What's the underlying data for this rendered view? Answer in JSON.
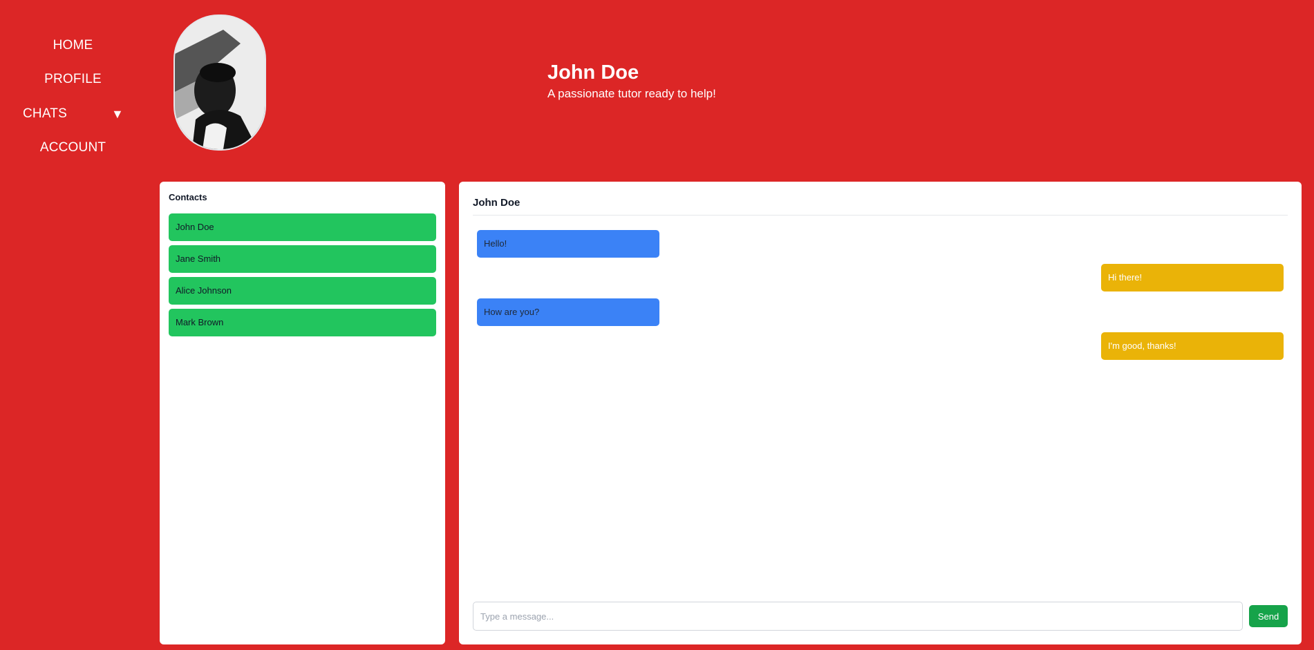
{
  "nav": {
    "home": "HOME",
    "profile": "PROFILE",
    "chats": "CHATS",
    "chats_arrow": "▼",
    "account": "ACCOUNT"
  },
  "profile": {
    "name": "John Doe",
    "tagline": "A passionate tutor ready to help!"
  },
  "contacts": {
    "title": "Contacts",
    "items": [
      {
        "name": "John Doe"
      },
      {
        "name": "Jane Smith"
      },
      {
        "name": "Alice Johnson"
      },
      {
        "name": "Mark Brown"
      }
    ]
  },
  "chat": {
    "header": "John Doe",
    "messages": [
      {
        "text": "Hello!",
        "direction": "incoming"
      },
      {
        "text": "Hi there!",
        "direction": "outgoing"
      },
      {
        "text": "How are you?",
        "direction": "incoming"
      },
      {
        "text": "I'm good, thanks!",
        "direction": "outgoing"
      }
    ],
    "input_placeholder": "Type a message...",
    "input_value": "",
    "send_label": "Send"
  },
  "colors": {
    "background": "#dc2626",
    "contact": "#22c55e",
    "incoming": "#3b82f6",
    "outgoing": "#eab308",
    "send": "#16a34a"
  }
}
